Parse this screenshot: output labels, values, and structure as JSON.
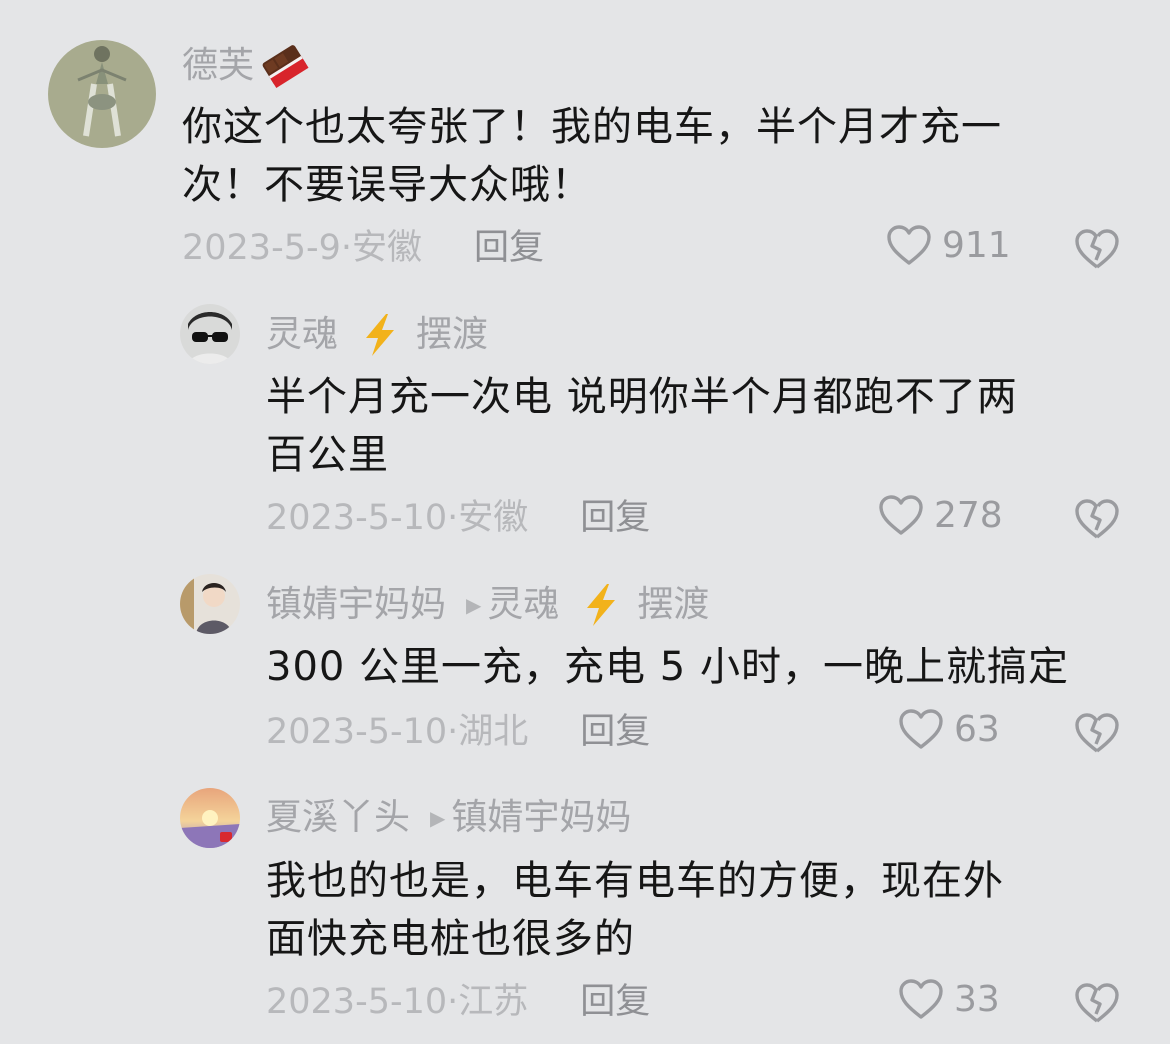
{
  "comments": [
    {
      "user": "德芙",
      "user_badge_icon": "chocolate-bar-emoji",
      "text_lines": [
        "你这个也太夸张了！我的电车，半个月才充一",
        "次！不要误导大众哦！"
      ],
      "date": "2023-5-9",
      "location": "安徽",
      "reply_label": "回复",
      "likes": "911"
    },
    {
      "user": "灵魂",
      "user_suffix_icon": "lightning-bolt-emoji",
      "user_suffix": "摆渡",
      "text_lines": [
        "半个月充一次电  说明你半个月都跑不了两",
        "百公里"
      ],
      "date": "2023-5-10",
      "location": "安徽",
      "reply_label": "回复",
      "likes": "278"
    },
    {
      "user": "镇婧宇妈妈",
      "reply_to_icon": "play-triangle-icon",
      "reply_to": "灵魂",
      "reply_to_suffix_icon": "lightning-bolt-emoji",
      "reply_to_suffix": "摆渡",
      "text_lines": [
        "300 公里一充，充电 5 小时，一晚上就搞定"
      ],
      "date": "2023-5-10",
      "location": "湖北",
      "reply_label": "回复",
      "likes": "63"
    },
    {
      "user": "夏溪丫头",
      "reply_to_icon": "play-triangle-icon",
      "reply_to": "镇婧宇妈妈",
      "text_lines": [
        "我也的也是，电车有电车的方便，现在外",
        "面快充电桩也很多的"
      ],
      "date": "2023-5-10",
      "location": "江苏",
      "reply_label": "回复",
      "likes": "33"
    }
  ],
  "colors": {
    "background": "#e4e5e7",
    "username": "#a4a5a9",
    "body_text": "#161616",
    "meta_text": "#b0b1b4",
    "icon": "#9a9b9f",
    "bolt": "#f2b21b"
  },
  "date_separator": "·"
}
